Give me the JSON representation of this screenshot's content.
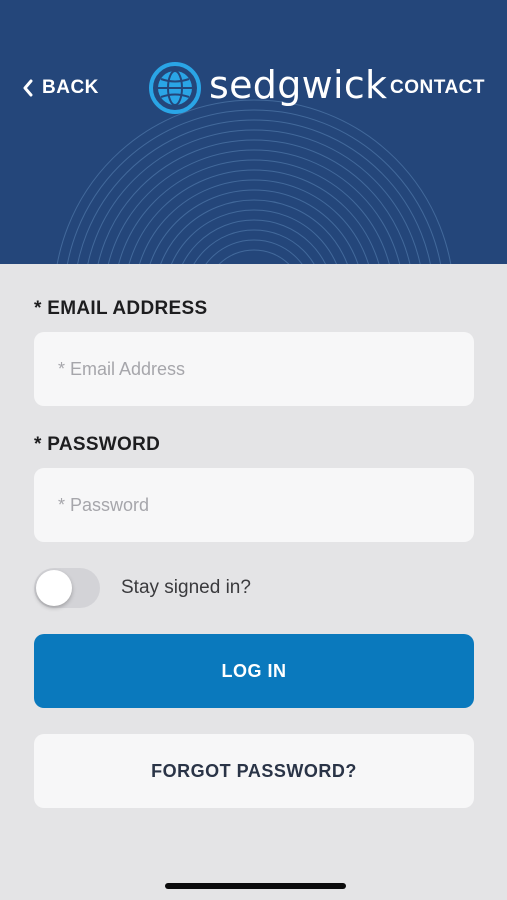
{
  "header": {
    "back_label": "BACK",
    "contact_label": "CONTACT",
    "brand_name": "sedgwick",
    "background_color": "#24467a"
  },
  "form": {
    "email_label": "* EMAIL ADDRESS",
    "email_placeholder": "* Email Address",
    "email_value": "",
    "password_label": "* PASSWORD",
    "password_placeholder": "* Password",
    "password_value": "",
    "stay_signed_in_label": "Stay signed in?",
    "stay_signed_in": false
  },
  "actions": {
    "login_label": "LOG IN",
    "forgot_password_label": "FORGOT PASSWORD?",
    "accent_color": "#0a79bd"
  }
}
